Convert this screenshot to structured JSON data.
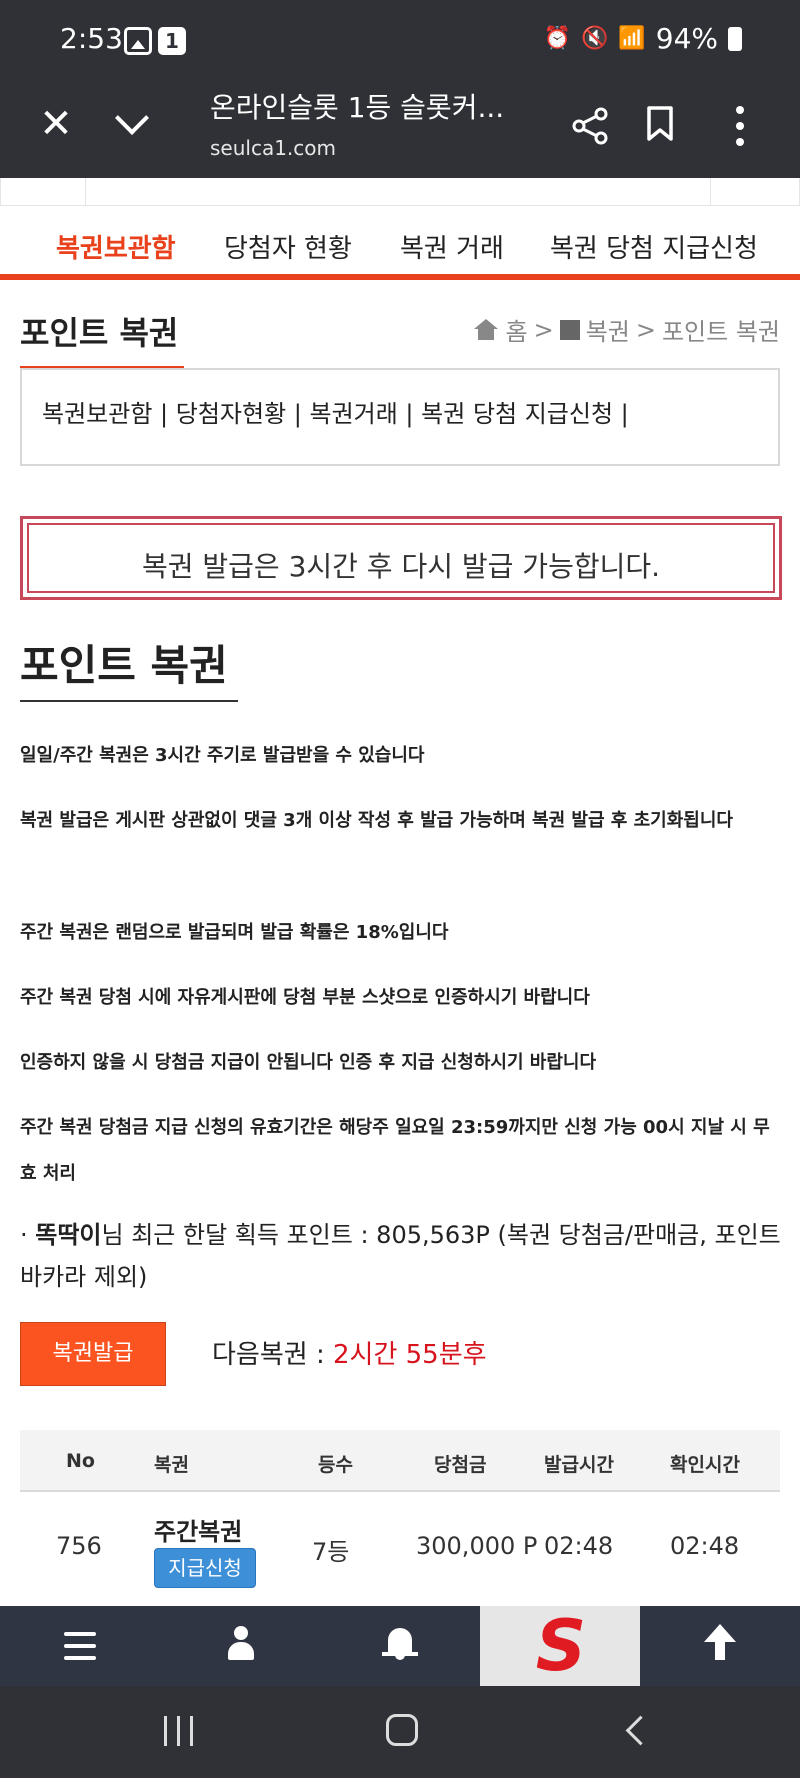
{
  "status_bar": {
    "time": "2:53",
    "notification_count": "1",
    "battery": "94%"
  },
  "browser": {
    "title": "온라인슬롯 1등 슬롯커...",
    "url": "seulca1.com"
  },
  "tabs": [
    {
      "label": "복권보관함",
      "active": true
    },
    {
      "label": "당첨자 현황",
      "active": false
    },
    {
      "label": "복권 거래",
      "active": false
    },
    {
      "label": "복권 당첨 지급신청",
      "active": false
    }
  ],
  "page": {
    "title": "포인트 복권",
    "breadcrumb": {
      "home": "홈",
      "sep": ">",
      "section": "복권",
      "current": "포인트 복권"
    }
  },
  "subnav": {
    "text": "복권보관함 | 당첨자현황 | 복권거래 | 복권 당첨 지급신청 |"
  },
  "alert": {
    "text": "복권 발급은 3시간 후 다시 발급 가능합니다."
  },
  "section": {
    "title": "포인트 복권",
    "rules": [
      "일일/주간 복권은 3시간 주기로 발급받을 수 있습니다",
      "복권 발급은 게시판 상관없이 댓글 3개 이상 작성 후 발급 가능하며 복권 발급 후 초기화됩니다",
      "주간 복권은 랜덤으로 발급되며 발급 확률은 18%입니다",
      "주간 복권 당첨 시에 자유게시판에 당첨 부분 스샷으로 인증하시기 바랍니다",
      "인증하지 않을 시 당첨금 지급이 안됩니다 인증 후 지급 신청하시기 바랍니다",
      "주간 복권 당첨금 지급 신청의 유효기간은 해당주 일요일 23:59까지만 신청 가능 00시 지날 시 무효 처리"
    ]
  },
  "user_info": {
    "prefix": "· ",
    "username": "똑딱이",
    "text": "님 최근 한달 획득 포인트 : 805,563P (복권 당첨금/판매금, 포인트 바카라 제외)"
  },
  "actions": {
    "issue_button": "복권발급",
    "next_label": "다음복권 : ",
    "next_value": "2시간 55분후"
  },
  "table": {
    "headers": [
      "No",
      "복권",
      "등수",
      "당첨금",
      "발급시간",
      "확인시간"
    ],
    "rows": [
      {
        "no": "756",
        "lottery": "주간복권",
        "claim_button": "지급신청",
        "rank": "7등",
        "prize": "300,000 P",
        "issued": "02:48",
        "checked": "02:48"
      }
    ]
  },
  "colors": {
    "accent": "#e8411b",
    "alert_border": "#c8485a",
    "button": "#fb5421",
    "claim": "#3d8fd8",
    "next_value": "#d7141e"
  },
  "icons": [
    "close-icon",
    "chevron-down-icon",
    "share-icon",
    "bookmark-icon",
    "more-icon",
    "home-icon",
    "menu-icon",
    "user-icon",
    "bell-icon",
    "arrow-up-icon"
  ]
}
